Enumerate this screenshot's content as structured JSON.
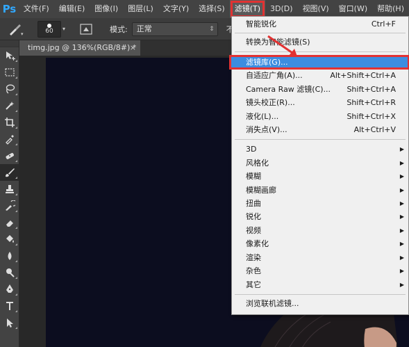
{
  "app": {
    "logo": "Ps"
  },
  "menubar": {
    "items": [
      {
        "label": "文件(F)"
      },
      {
        "label": "编辑(E)"
      },
      {
        "label": "图像(I)"
      },
      {
        "label": "图层(L)"
      },
      {
        "label": "文字(Y)"
      },
      {
        "label": "选择(S)"
      },
      {
        "label": "滤镜(T)"
      },
      {
        "label": "3D(D)"
      },
      {
        "label": "视图(V)"
      },
      {
        "label": "窗口(W)"
      },
      {
        "label": "帮助(H)"
      }
    ]
  },
  "options": {
    "brush_size": "60",
    "mode_label": "模式:",
    "mode_value": "正常",
    "opacity_label": "不透明"
  },
  "tab": {
    "title": "timg.jpg @ 136%(RGB/8#) *",
    "close": "×"
  },
  "filter_menu": {
    "items": [
      {
        "label": "智能锐化",
        "shortcut": "Ctrl+F"
      },
      {
        "label": "转换为智能滤镜(S)",
        "shortcut": ""
      },
      {
        "label": "滤镜库(G)...",
        "shortcut": ""
      },
      {
        "label": "自适应广角(A)...",
        "shortcut": "Alt+Shift+Ctrl+A"
      },
      {
        "label": "Camera Raw 滤镜(C)...",
        "shortcut": "Shift+Ctrl+A"
      },
      {
        "label": "镜头校正(R)...",
        "shortcut": "Shift+Ctrl+R"
      },
      {
        "label": "液化(L)...",
        "shortcut": "Shift+Ctrl+X"
      },
      {
        "label": "消失点(V)...",
        "shortcut": "Alt+Ctrl+V"
      },
      {
        "label": "3D",
        "shortcut": ""
      },
      {
        "label": "风格化",
        "shortcut": ""
      },
      {
        "label": "模糊",
        "shortcut": ""
      },
      {
        "label": "模糊画廊",
        "shortcut": ""
      },
      {
        "label": "扭曲",
        "shortcut": ""
      },
      {
        "label": "锐化",
        "shortcut": ""
      },
      {
        "label": "视频",
        "shortcut": ""
      },
      {
        "label": "像素化",
        "shortcut": ""
      },
      {
        "label": "渲染",
        "shortcut": ""
      },
      {
        "label": "杂色",
        "shortcut": ""
      },
      {
        "label": "其它",
        "shortcut": ""
      },
      {
        "label": "浏览联机滤镜...",
        "shortcut": ""
      }
    ]
  },
  "toolbar": {
    "tools": [
      "move-tool",
      "marquee-tool",
      "lasso-tool",
      "quick-select-tool",
      "crop-tool",
      "eyedropper-tool",
      "healing-tool",
      "brush-tool",
      "stamp-tool",
      "history-brush-tool",
      "eraser-tool",
      "paint-bucket-tool",
      "blur-tool",
      "dodge-tool",
      "pen-tool",
      "type-tool",
      "path-select-tool"
    ]
  },
  "colors": {
    "accent": "#3c8de0",
    "annotation": "#e23232",
    "ps_blue": "#31a8ff"
  }
}
